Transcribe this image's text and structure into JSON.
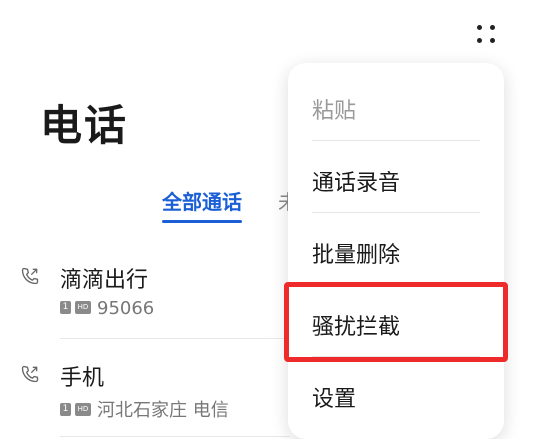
{
  "header": {
    "title": "电话",
    "more_icon": "more-dots-icon"
  },
  "tabs": [
    {
      "label": "全部通话",
      "active": true
    },
    {
      "label": "未",
      "active": false
    }
  ],
  "calls": [
    {
      "name": "滴滴出行",
      "sim": "1",
      "hd": "HD",
      "detail": "95066",
      "icon": "outgoing-call-icon"
    },
    {
      "name": "手机",
      "sim": "1",
      "hd": "HD",
      "detail": "河北石家庄 电信",
      "icon": "outgoing-call-icon"
    }
  ],
  "menu": {
    "items": [
      {
        "label": "粘贴",
        "disabled": true
      },
      {
        "label": "通话录音",
        "disabled": false
      },
      {
        "label": "批量删除",
        "disabled": false
      },
      {
        "label": "骚扰拦截",
        "disabled": false,
        "highlighted": true
      },
      {
        "label": "设置",
        "disabled": false
      }
    ]
  },
  "colors": {
    "accent": "#1a5fd6",
    "highlight": "#ef2a2a",
    "text": "#1a1a1a",
    "muted": "#777777"
  }
}
